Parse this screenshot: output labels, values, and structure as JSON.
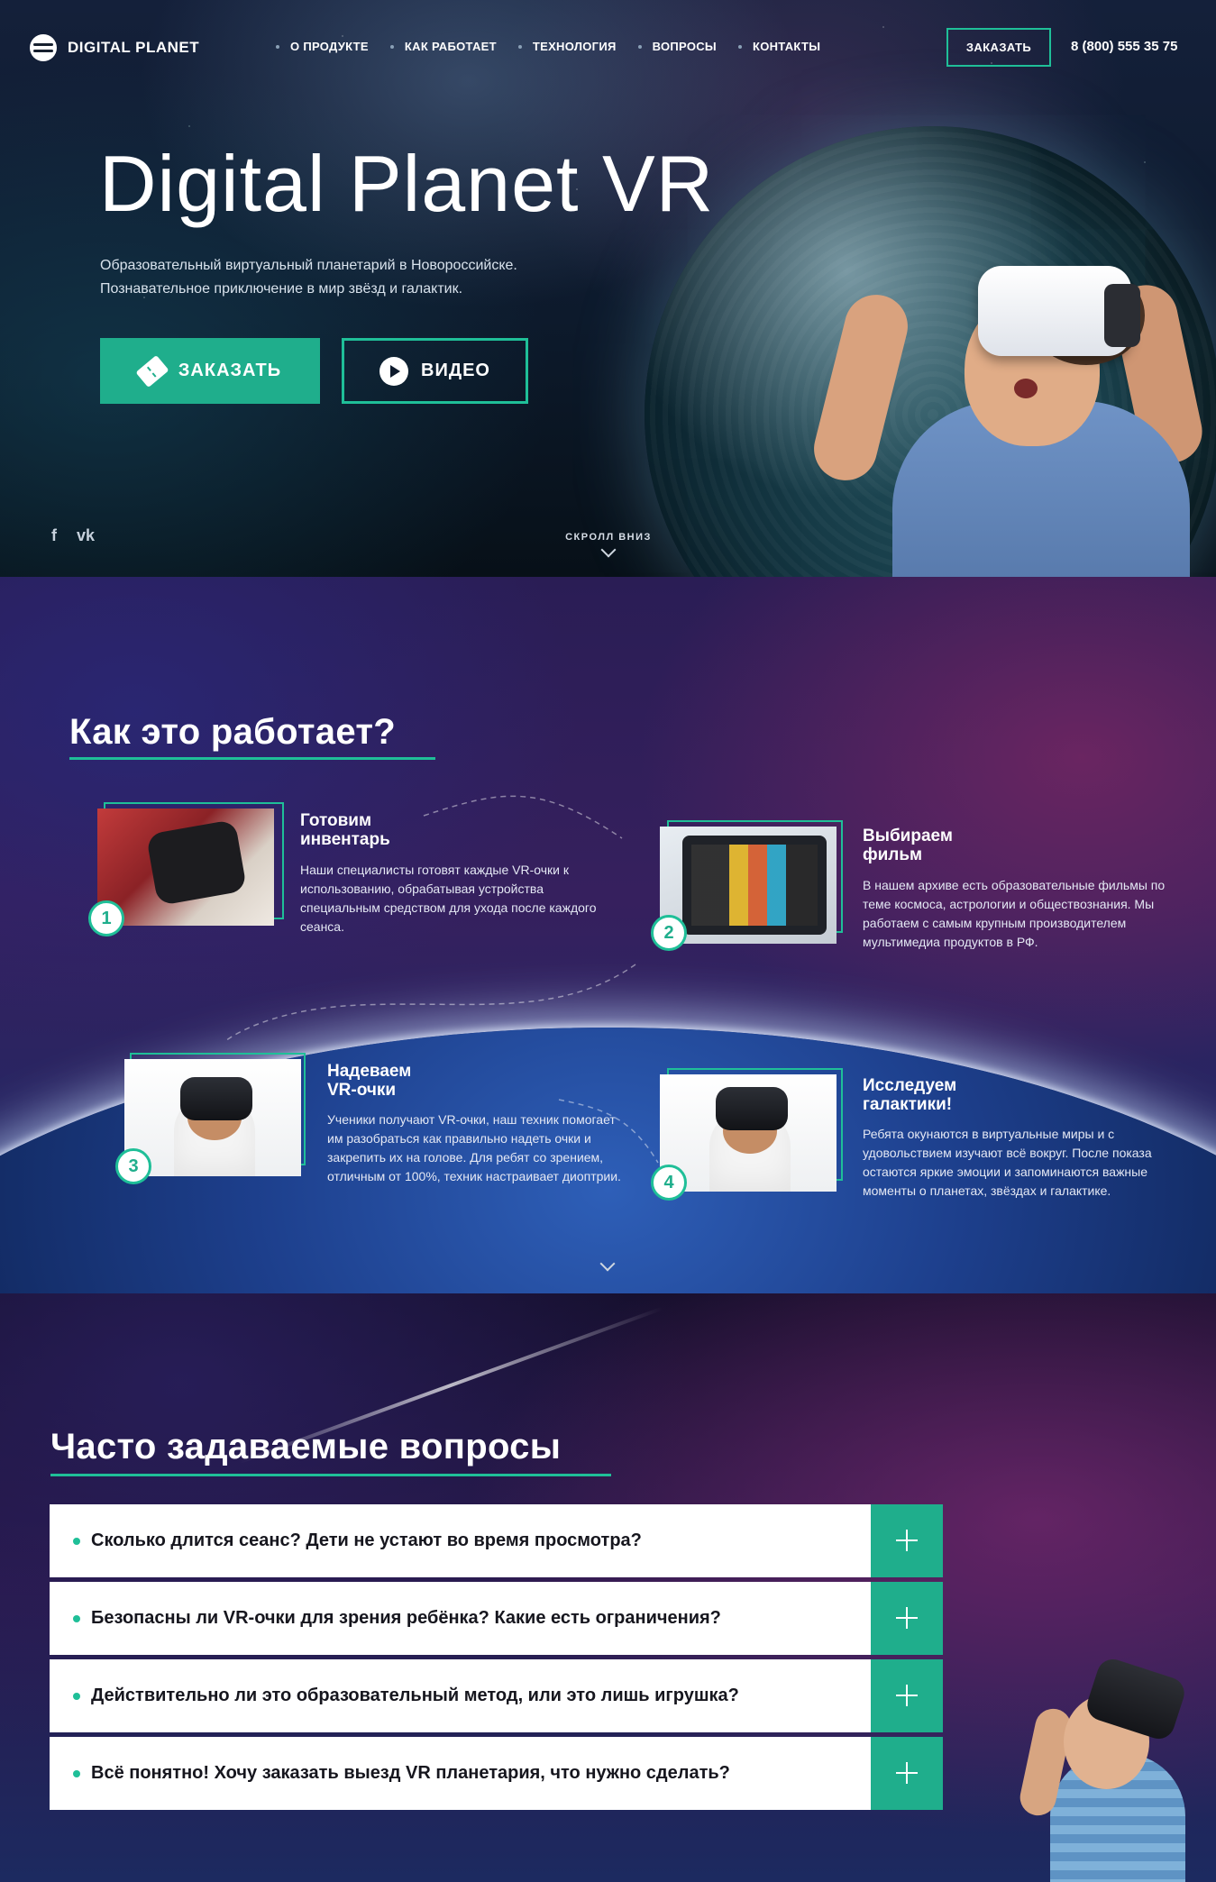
{
  "brand": {
    "name": "DIGITAL PLANET"
  },
  "nav": {
    "items": [
      "О ПРОДУКТЕ",
      "КАК РАБОТАЕТ",
      "ТЕХНОЛОГИЯ",
      "ВОПРОСЫ",
      "КОНТАКТЫ"
    ],
    "order_label": "ЗАКАЗАТЬ",
    "phone": "8 (800) 555 35 75"
  },
  "hero": {
    "title": "Digital Planet VR",
    "subtitle_line1": "Образовательный виртуальный планетарий в Новороссийске.",
    "subtitle_line2": "Познавательное приключение в мир звёзд и галактик.",
    "order_button": "ЗАКАЗАТЬ",
    "video_button": "ВИДЕО",
    "social": [
      "f",
      "vk"
    ],
    "scroll_label": "СКРОЛЛ ВНИЗ"
  },
  "how": {
    "title": "Как это работает?",
    "steps": [
      {
        "num": "1",
        "title_line1": "Готовим",
        "title_line2": "инвентарь",
        "text": "Наши специалисты готовят каждые VR-очки к использованию, обрабатывая устройства специальным средством для ухода после каждого сеанса."
      },
      {
        "num": "2",
        "title_line1": "Выбираем",
        "title_line2": "фильм",
        "text": "В нашем архиве есть образовательные фильмы по теме космоса, астрологии и обществознания. Мы работаем с самым крупным производителем мультимедиа продуктов в РФ."
      },
      {
        "num": "3",
        "title_line1": "Надеваем",
        "title_line2": "VR-очки",
        "text": "Ученики получают VR-очки, наш техник помогает им разобраться как правильно надеть очки и закрепить их на голове. Для ребят со зрением, отличным от 100%, техник настраивает диоптрии."
      },
      {
        "num": "4",
        "title_line1": "Исследуем",
        "title_line2": "галактики!",
        "text": "Ребята окунаются в виртуальные миры и с удовольствием изучают всё вокруг. После показа остаются яркие эмоции и запоминаются важные моменты о планетах, звёздах и галактике."
      }
    ]
  },
  "faq": {
    "title": "Часто задаваемые вопросы",
    "items": [
      "Сколько длится сеанс? Дети не устают во время просмотра?",
      "Безопасны ли VR-очки для зрения ребёнка? Какие есть ограничения?",
      "Действительно ли это образовательный метод, или это лишь игрушка?",
      "Всё понятно! Хочу заказать выезд VR планетария, что нужно сделать?"
    ]
  },
  "colors": {
    "accent": "#1fbf98",
    "accent_fill": "#1fae8c"
  }
}
